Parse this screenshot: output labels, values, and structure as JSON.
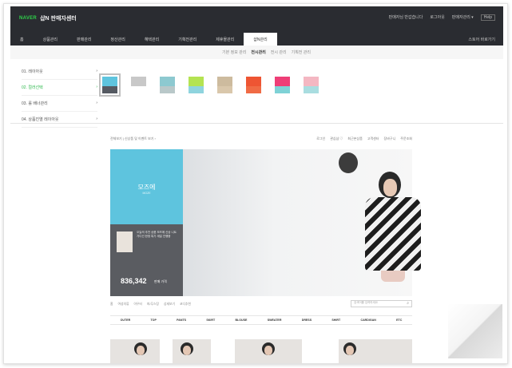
{
  "header": {
    "logo": "NAVER",
    "title": "샵N 판매자센터",
    "util": [
      "판매자님 반갑습니다",
      "로그아웃",
      "판매자관리 ▾"
    ],
    "util_box": "Help"
  },
  "nav": {
    "items": [
      "홈",
      "상품관리",
      "판매관리",
      "정산관리",
      "혜택관리",
      "기획전관리",
      "제휴몰관리",
      "샵N관리"
    ],
    "active_index": 7,
    "help": "스토어 바로가기"
  },
  "subtabs": [
    "기본 정보 관리",
    "전시관리",
    "전시 관리",
    "기획전 관리"
  ],
  "subtabs_active": 1,
  "side_menu": [
    {
      "label": "01. 레이아웃",
      "arrow": "›"
    },
    {
      "label": "02. 컬러선택",
      "arrow": "›"
    },
    {
      "label": "03. 롤 배너관리",
      "arrow": "›"
    },
    {
      "label": "04. 상품진열 레이아웃",
      "arrow": "›"
    }
  ],
  "side_menu_active": 1,
  "swatches": [
    {
      "top": "#5ec4de",
      "bottom": "#555a62",
      "selected": true
    },
    {
      "top": "#c8c8c8",
      "bottom": "#ffffff",
      "selected": false
    },
    {
      "top": "#8dc9d0",
      "bottom": "#b9c8c9",
      "selected": false
    },
    {
      "top": "#b4e352",
      "bottom": "#8fd4de",
      "selected": false
    },
    {
      "top": "#cdbb9e",
      "bottom": "#d9c7ab",
      "selected": false
    },
    {
      "top": "#ee5533",
      "bottom": "#f06b45",
      "selected": false
    },
    {
      "top": "#ee3e77",
      "bottom": "#7ed2d6",
      "selected": false
    },
    {
      "top": "#f4b7c2",
      "bottom": "#a9dde0",
      "selected": false
    }
  ],
  "preview": {
    "head_left": "전체보기 | 신상품 및 이벤트 보기 ›",
    "head_right": [
      "로그인",
      "관심샵 ♡",
      "최근본상품",
      "고객센터",
      "장바구니",
      "주문조회"
    ],
    "store_name": "모즈에",
    "store_sub": "MOZE",
    "desc": "오늘의 추천 상품 모즈에 신상 니트 가디건 한정 특가 세일 진행중",
    "price": "836,342",
    "price_tag": "판매 가격",
    "crumbs": [
      "홈",
      "여성의류",
      "아우터",
      "퍼/무스탕",
      "상세보기",
      "코디추천"
    ],
    "search_placeholder": "검색어를 입력하세요",
    "categories": [
      "OUTER",
      "TOP",
      "PANTS",
      "SKIRT",
      "BLOUSE",
      "SWEATER",
      "DRESS",
      "SHIRT",
      "CARDIGAN",
      "ETC"
    ]
  },
  "icons": {
    "search": "search-icon",
    "arrow": "chevron-right-icon"
  }
}
